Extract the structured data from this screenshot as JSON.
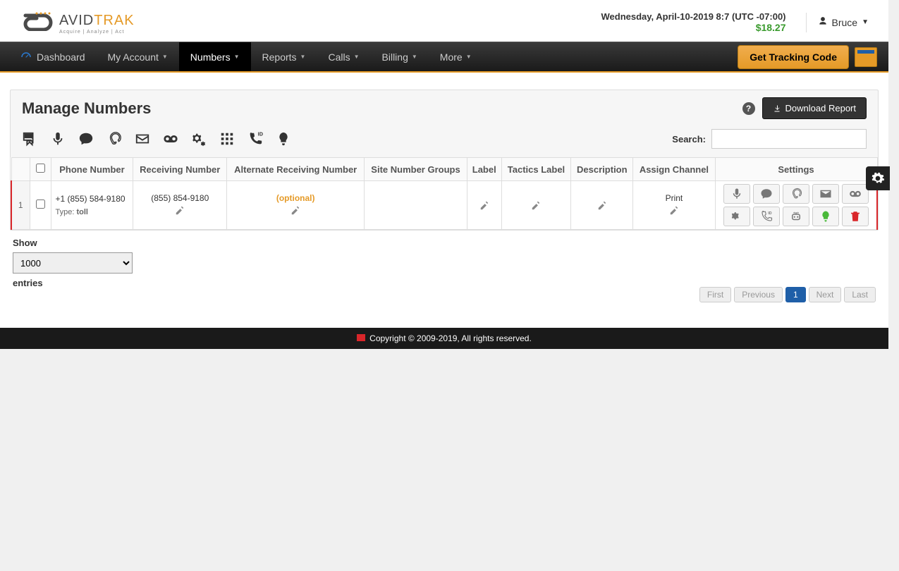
{
  "header": {
    "logo_text1": "AVID",
    "logo_text2": "TRAK",
    "logo_tag": "Acquire | Analyze | Act",
    "date": "Wednesday, April-10-2019 8:7 (UTC -07:00)",
    "balance": "$18.27",
    "user": "Bruce"
  },
  "nav": {
    "items": [
      {
        "label": "Dashboard",
        "caret": false,
        "icon": true
      },
      {
        "label": "My Account",
        "caret": true
      },
      {
        "label": "Numbers",
        "caret": true,
        "active": true
      },
      {
        "label": "Reports",
        "caret": true
      },
      {
        "label": "Calls",
        "caret": true
      },
      {
        "label": "Billing",
        "caret": true
      },
      {
        "label": "More",
        "caret": true
      }
    ],
    "tracking_btn": "Get Tracking Code"
  },
  "page": {
    "title": "Manage Numbers",
    "download_btn": "Download Report",
    "search_label": "Search:"
  },
  "table": {
    "headers": [
      "",
      "",
      "Phone Number",
      "Receiving Number",
      "Alternate Receiving Number",
      "Site Number Groups",
      "Label",
      "Tactics Label",
      "Description",
      "Assign Channel",
      "Settings"
    ],
    "rows": [
      {
        "num": "1",
        "phone": "+1 (855) 584-9180",
        "type_label": "Type: ",
        "type_value": "toll",
        "receiving": "(855) 854-9180",
        "alternate": "(optional)",
        "channel": "Print"
      }
    ]
  },
  "show": {
    "label": "Show",
    "value": "1000",
    "suffix": "entries"
  },
  "pager": {
    "first": "First",
    "prev": "Previous",
    "page": "1",
    "next": "Next",
    "last": "Last"
  },
  "footer": "Copyright © 2009-2019, All rights reserved."
}
